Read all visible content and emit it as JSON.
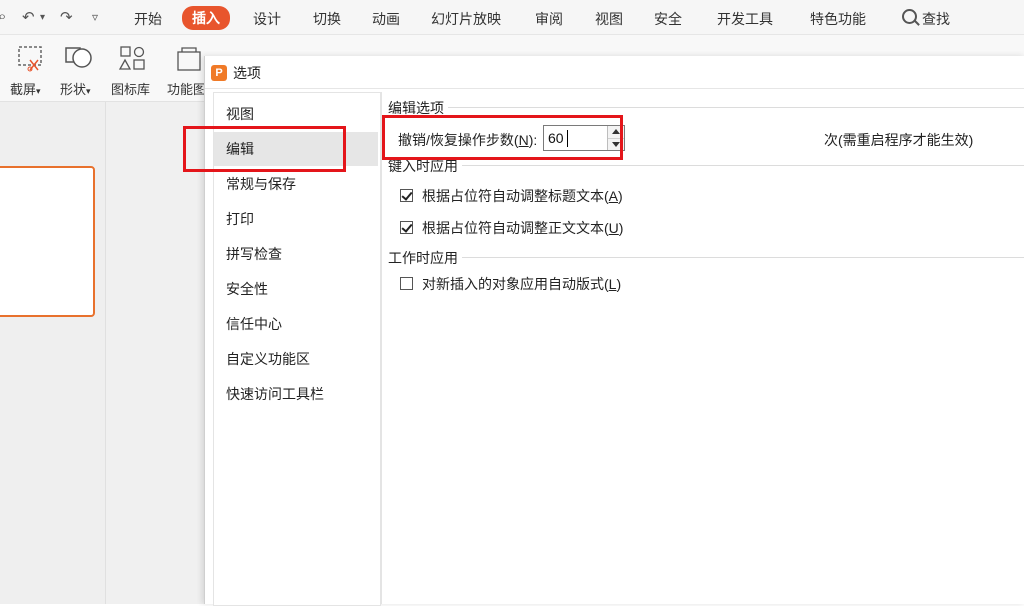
{
  "menubar": {
    "tabs": [
      "开始",
      "插入",
      "设计",
      "切换",
      "动画",
      "幻灯片放映",
      "审阅",
      "视图",
      "安全",
      "开发工具",
      "特色功能"
    ],
    "active_tab": "插入",
    "search_label": "查找",
    "accent_color": "#e8552d"
  },
  "ribbon": {
    "items": [
      {
        "label": "截屏",
        "icon": "screenshot-icon"
      },
      {
        "label": "形状",
        "icon": "shapes-icon"
      },
      {
        "label": "图标库",
        "icon": "icon-library-icon"
      },
      {
        "label": "功能图",
        "icon": "function-chart-icon"
      }
    ]
  },
  "dialog": {
    "title": "选项",
    "nav_items": [
      "视图",
      "编辑",
      "常规与保存",
      "打印",
      "拼写检查",
      "安全性",
      "信任中心",
      "自定义功能区",
      "快速访问工具栏"
    ],
    "selected_nav": "编辑",
    "edit_options": {
      "group_title": "编辑选项",
      "undo_label": "撤销/恢复操作步数(",
      "undo_key": "N",
      "undo_label_end": "):",
      "undo_value": "60",
      "undo_suffix": "次(需重启程序才能生效)"
    },
    "typing_group": {
      "group_title": "键入时应用",
      "items": [
        {
          "label": "根据占位符自动调整标题文本(",
          "key": "A",
          "end": ")",
          "checked": true
        },
        {
          "label": "根据占位符自动调整正文文本(",
          "key": "U",
          "end": ")",
          "checked": true
        }
      ]
    },
    "working_group": {
      "group_title": "工作时应用",
      "items": [
        {
          "label": "对新插入的对象应用自动版式(",
          "key": "L",
          "end": ")",
          "checked": false
        }
      ]
    }
  },
  "highlight_color": "#e4151a"
}
